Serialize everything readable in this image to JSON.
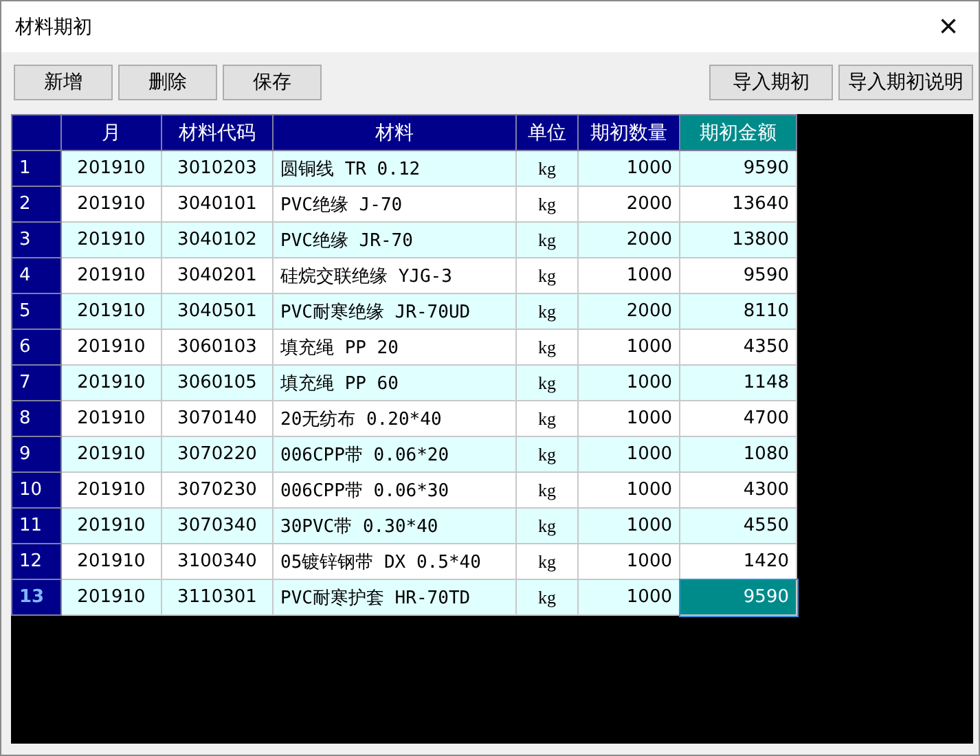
{
  "window": {
    "title": "材料期初",
    "close": "×"
  },
  "toolbar": {
    "left": [
      "新增",
      "删除",
      "保存"
    ],
    "right": [
      "导入期初",
      "导入期初说明"
    ]
  },
  "table": {
    "columns": [
      {
        "label": "月",
        "selected": false
      },
      {
        "label": "材料代码",
        "selected": false
      },
      {
        "label": "材料",
        "selected": false
      },
      {
        "label": "单位",
        "selected": false
      },
      {
        "label": "期初数量",
        "selected": false
      },
      {
        "label": "期初金额",
        "selected": true
      }
    ],
    "rows": [
      {
        "num": "1",
        "month": "201910",
        "code": "3010203",
        "material": "圆铜线 TR 0.12",
        "unit": "kg",
        "qty": "1000",
        "amount": "9590",
        "selected": false
      },
      {
        "num": "2",
        "month": "201910",
        "code": "3040101",
        "material": "PVC绝缘 J-70",
        "unit": "kg",
        "qty": "2000",
        "amount": "13640",
        "selected": false
      },
      {
        "num": "3",
        "month": "201910",
        "code": "3040102",
        "material": "PVC绝缘 JR-70",
        "unit": "kg",
        "qty": "2000",
        "amount": "13800",
        "selected": false
      },
      {
        "num": "4",
        "month": "201910",
        "code": "3040201",
        "material": "硅烷交联绝缘 YJG-3",
        "unit": "kg",
        "qty": "1000",
        "amount": "9590",
        "selected": false
      },
      {
        "num": "5",
        "month": "201910",
        "code": "3040501",
        "material": "PVC耐寒绝缘 JR-70UD",
        "unit": "kg",
        "qty": "2000",
        "amount": "8110",
        "selected": false
      },
      {
        "num": "6",
        "month": "201910",
        "code": "3060103",
        "material": "填充绳 PP 20",
        "unit": "kg",
        "qty": "1000",
        "amount": "4350",
        "selected": false
      },
      {
        "num": "7",
        "month": "201910",
        "code": "3060105",
        "material": "填充绳 PP 60",
        "unit": "kg",
        "qty": "1000",
        "amount": "1148",
        "selected": false
      },
      {
        "num": "8",
        "month": "201910",
        "code": "3070140",
        "material": "20无纺布 0.20*40",
        "unit": "kg",
        "qty": "1000",
        "amount": "4700",
        "selected": false
      },
      {
        "num": "9",
        "month": "201910",
        "code": "3070220",
        "material": "006CPP带 0.06*20",
        "unit": "kg",
        "qty": "1000",
        "amount": "1080",
        "selected": false
      },
      {
        "num": "10",
        "month": "201910",
        "code": "3070230",
        "material": "006CPP带 0.06*30",
        "unit": "kg",
        "qty": "1000",
        "amount": "4300",
        "selected": false
      },
      {
        "num": "11",
        "month": "201910",
        "code": "3070340",
        "material": "30PVC带 0.30*40",
        "unit": "kg",
        "qty": "1000",
        "amount": "4550",
        "selected": false
      },
      {
        "num": "12",
        "month": "201910",
        "code": "3100340",
        "material": "05镀锌钢带 DX 0.5*40",
        "unit": "kg",
        "qty": "1000",
        "amount": "1420",
        "selected": false
      },
      {
        "num": "13",
        "month": "201910",
        "code": "3110301",
        "material": "PVC耐寒护套 HR-70TD",
        "unit": "kg",
        "qty": "1000",
        "amount": "9590",
        "selected": true
      }
    ]
  }
}
